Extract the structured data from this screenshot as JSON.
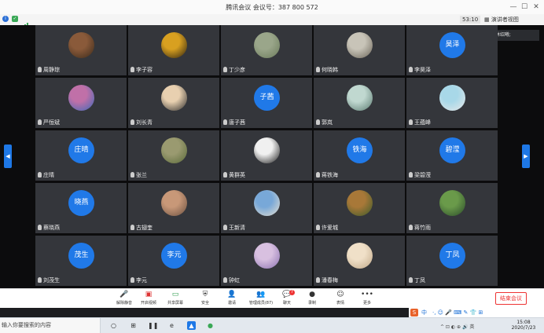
{
  "window": {
    "title": "腾讯会议  会议号：387 800 572",
    "controls": {
      "minimize": "—",
      "maximize": "☐",
      "close": "✕"
    }
  },
  "top_bar": {
    "timer": "53:10",
    "speaker_view": "演讲者视图",
    "icons": [
      "info-icon",
      "shield-icon",
      "signal-icon"
    ]
  },
  "speaking_label": "正在讲话: 林绍曦;",
  "nav": {
    "prev": "◀",
    "next": "▶"
  },
  "participants": [
    {
      "name": "周静琮",
      "avatar_text": "",
      "colors": [
        "#8a5a3a",
        "#3a2a1a"
      ]
    },
    {
      "name": "李子容",
      "avatar_text": "",
      "colors": [
        "#d8a020",
        "#2a2010"
      ]
    },
    {
      "name": "丁少彦",
      "avatar_text": "",
      "colors": [
        "#9aa68a",
        "#6a7a5a"
      ]
    },
    {
      "name": "何晓韩",
      "avatar_text": "",
      "colors": [
        "#c8c4b8",
        "#6a6458"
      ]
    },
    {
      "name": "李昊泽",
      "avatar_text": "昊泽",
      "colors": [
        "#2079e8",
        "#2079e8"
      ]
    },
    {
      "name": "严恒斌",
      "avatar_text": "",
      "colors": [
        "#c070a8",
        "#3a6ab8"
      ]
    },
    {
      "name": "刘长青",
      "avatar_text": "",
      "colors": [
        "#e8d0b0",
        "#2a2a2a"
      ]
    },
    {
      "name": "唐子茜",
      "avatar_text": "子茜",
      "colors": [
        "#2079e8",
        "#2079e8"
      ]
    },
    {
      "name": "郭岚",
      "avatar_text": "",
      "colors": [
        "#c0d8d0",
        "#5a7a70"
      ]
    },
    {
      "name": "王蕴峰",
      "avatar_text": "",
      "colors": [
        "#a8d8e8",
        "#e8e8e8"
      ]
    },
    {
      "name": "庄晴",
      "avatar_text": "庄晴",
      "colors": [
        "#2079e8",
        "#2079e8"
      ]
    },
    {
      "name": "张兰",
      "avatar_text": "",
      "colors": [
        "#9a9a70",
        "#5a6a3a"
      ]
    },
    {
      "name": "黄群英",
      "avatar_text": "",
      "colors": [
        "#f0f0f0",
        "#1a1a1a"
      ]
    },
    {
      "name": "蒋铁海",
      "avatar_text": "铁海",
      "colors": [
        "#2079e8",
        "#2079e8"
      ]
    },
    {
      "name": "梁碧滢",
      "avatar_text": "碧滢",
      "colors": [
        "#2079e8",
        "#2079e8"
      ]
    },
    {
      "name": "蔡晓燕",
      "avatar_text": "晓燕",
      "colors": [
        "#2079e8",
        "#2079e8"
      ]
    },
    {
      "name": "古翅奎",
      "avatar_text": "",
      "colors": [
        "#c89878",
        "#6a5040"
      ]
    },
    {
      "name": "王新清",
      "avatar_text": "",
      "colors": [
        "#78a8d8",
        "#e8e0d0"
      ]
    },
    {
      "name": "许爱城",
      "avatar_text": "",
      "colors": [
        "#a87838",
        "#3a5a2a"
      ]
    },
    {
      "name": "蒋竹雨",
      "avatar_text": "",
      "colors": [
        "#6a9a4a",
        "#2a4a2a"
      ]
    },
    {
      "name": "刘茂生",
      "avatar_text": "茂生",
      "colors": [
        "#2079e8",
        "#2079e8"
      ]
    },
    {
      "name": "李元",
      "avatar_text": "李元",
      "colors": [
        "#2079e8",
        "#2079e8"
      ]
    },
    {
      "name": "钟虹",
      "avatar_text": "",
      "colors": [
        "#d8c0e0",
        "#8a70b0"
      ]
    },
    {
      "name": "潘春梅",
      "avatar_text": "",
      "colors": [
        "#f0e0c8",
        "#c0a888"
      ]
    },
    {
      "name": "丁凤",
      "avatar_text": "丁凤",
      "colors": [
        "#2079e8",
        "#2079e8"
      ]
    }
  ],
  "toolbar": {
    "buttons": [
      {
        "name": "mute-button",
        "icon": "mic-icon",
        "glyph": "🎤",
        "label": "解除静音"
      },
      {
        "name": "video-button",
        "icon": "camera-off-icon",
        "glyph": "▣",
        "label": "开启视频"
      },
      {
        "name": "share-screen-button",
        "icon": "screen-share-icon",
        "glyph": "▭",
        "label": "共享屏幕"
      },
      {
        "name": "security-button",
        "icon": "shield-icon",
        "glyph": "⛨",
        "label": "安全"
      },
      {
        "name": "invite-button",
        "icon": "person-add-icon",
        "glyph": "👤",
        "label": "邀请"
      },
      {
        "name": "manage-members-button",
        "icon": "people-icon",
        "glyph": "👥",
        "label": "管理成员(87)"
      },
      {
        "name": "chat-button",
        "icon": "chat-icon",
        "glyph": "💬",
        "label": "聊天",
        "badge": "7"
      },
      {
        "name": "record-button",
        "icon": "record-icon",
        "glyph": "●",
        "label": "录制"
      },
      {
        "name": "reactions-button",
        "icon": "smile-icon",
        "glyph": "☺",
        "label": "表情"
      },
      {
        "name": "more-button",
        "icon": "more-icon",
        "glyph": "•••",
        "label": "更多"
      }
    ],
    "end_meeting": "结束会议"
  },
  "ime_bar": {
    "brand": "S",
    "mode": "中",
    "items": [
      "·,",
      "☺",
      "🎤",
      "⌨",
      "✎",
      "👕",
      "⊞"
    ]
  },
  "taskbar": {
    "search_placeholder": "输入你要搜索的内容",
    "apps": [
      "○",
      "⊞",
      "❚❚",
      "e",
      "▲",
      "●"
    ],
    "tray": "^ ⊡ ◐ ⊕ 🔊 英",
    "time": "15:08",
    "date": "2020/7/23"
  }
}
